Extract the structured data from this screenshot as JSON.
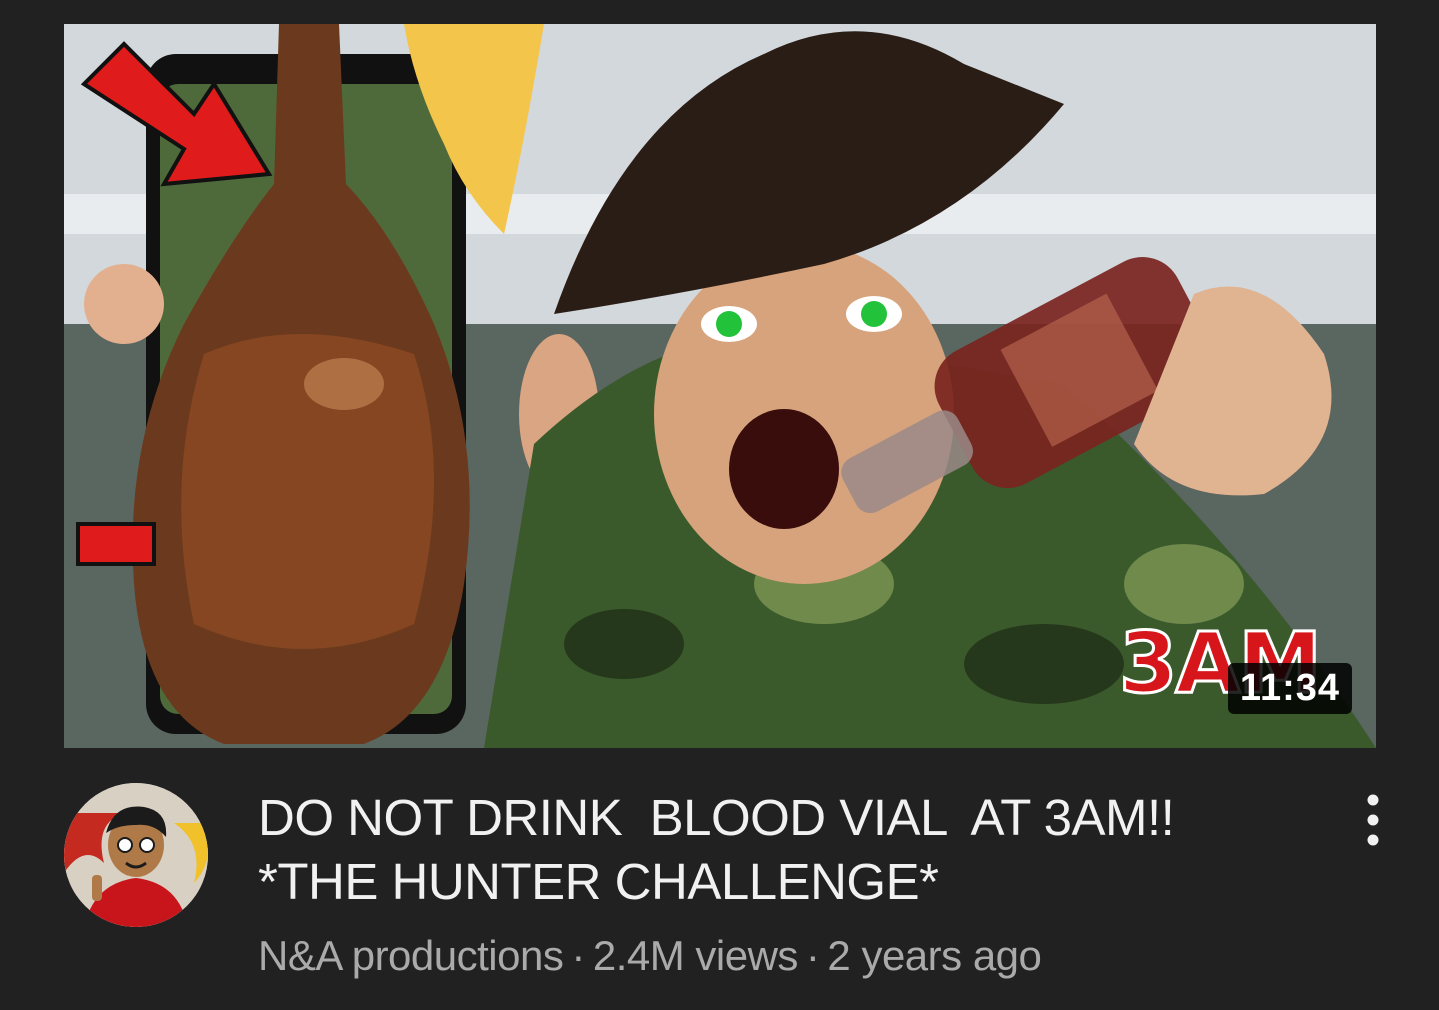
{
  "video": {
    "title_line1": "DO NOT DRINK  BLOOD VIAL  AT 3AM!!",
    "title_line2": "*THE HUNTER CHALLENGE*",
    "channel": "N&A productions",
    "views": "2.4M views",
    "age": "2 years ago",
    "separator": "·",
    "duration": "11:34"
  },
  "thumbnail": {
    "overlay_text": "3AM",
    "subjects": [
      "red-arrow-icon",
      "blood-bottle",
      "pirate-hat",
      "screaming-man",
      "glass-bottle",
      "phone-frame"
    ]
  },
  "menu": {
    "icon": "vertical-ellipsis-icon"
  },
  "colors": {
    "background": "#212121",
    "title": "#f1f1f1",
    "meta": "#aaaaaa",
    "accent_red": "#d7161c",
    "duration_bg": "#000000"
  }
}
